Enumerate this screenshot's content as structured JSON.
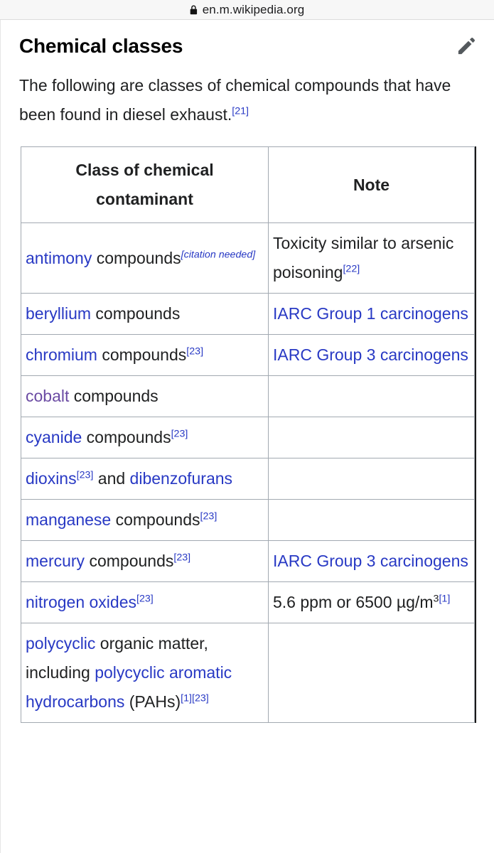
{
  "browser": {
    "lock_icon": "lock-icon",
    "url": "en.m.wikipedia.org"
  },
  "section": {
    "title": "Chemical classes",
    "edit_icon": "pencil-icon",
    "intro_text": "The following are classes of chemical compounds that have been found in diesel exhaust.",
    "intro_ref": "[21]"
  },
  "colors": {
    "link_blue": "#2839c4",
    "visited_purple": "#6b4ba3",
    "table_border": "#a2a9b1",
    "text": "#202122"
  },
  "table": {
    "headers": [
      "Class of chemical contaminant",
      "Note"
    ],
    "rows": [
      {
        "contaminant": {
          "link": "antimony",
          "link_state": "unvisited",
          "after": " compounds",
          "refs": [
            "[citation needed]"
          ],
          "ref_style": "citation-needed"
        },
        "note": {
          "text": "Toxicity similar to arsenic poisoning",
          "refs": [
            "[22]"
          ],
          "is_link": false
        }
      },
      {
        "contaminant": {
          "link": "beryllium",
          "link_state": "unvisited",
          "after": " compounds",
          "refs": []
        },
        "note": {
          "text": "IARC Group 1 carcinogens",
          "refs": [],
          "is_link": true
        }
      },
      {
        "contaminant": {
          "link": "chromium",
          "link_state": "unvisited",
          "after": " compounds",
          "refs": [
            "[23]"
          ]
        },
        "note": {
          "text": "IARC Group 3 carcinogens",
          "refs": [],
          "is_link": true
        }
      },
      {
        "contaminant": {
          "link": "cobalt",
          "link_state": "visited",
          "after": " compounds",
          "refs": []
        },
        "note": {
          "text": "",
          "refs": [],
          "is_link": false
        }
      },
      {
        "contaminant": {
          "link": "cyanide",
          "link_state": "unvisited",
          "after": " compounds",
          "refs": [
            "[23]"
          ]
        },
        "note": {
          "text": "",
          "refs": [],
          "is_link": false
        }
      },
      {
        "contaminant": {
          "link": "dioxins",
          "link_state": "unvisited",
          "after": "",
          "refs": [
            "[23]"
          ],
          "tail_text": " and ",
          "tail_link": "dibenzofurans"
        },
        "note": {
          "text": "",
          "refs": [],
          "is_link": false
        }
      },
      {
        "contaminant": {
          "link": "manganese",
          "link_state": "unvisited",
          "after": " compounds",
          "refs": [
            "[23]"
          ]
        },
        "note": {
          "text": "",
          "refs": [],
          "is_link": false
        }
      },
      {
        "contaminant": {
          "link": "mercury",
          "link_state": "unvisited",
          "after": " compounds",
          "refs": [
            "[23]"
          ]
        },
        "note": {
          "text": "IARC Group 3 carcinogens",
          "refs": [],
          "is_link": true
        }
      },
      {
        "contaminant": {
          "link": "nitrogen oxides",
          "link_state": "unvisited",
          "after": "",
          "refs": [
            "[23]"
          ]
        },
        "note": {
          "text": "5.6 ppm or 6500 µg/m3",
          "note_prefix": "5.6 ppm or 6500 µg/m",
          "note_sup": "3",
          "refs": [
            "[1]"
          ],
          "is_link": false
        }
      },
      {
        "contaminant": {
          "link": "polycyclic",
          "link_state": "unvisited",
          "after": " organic matter, including ",
          "link2": "polycyclic aromatic hydrocarbons",
          "after2": " (PAHs)",
          "refs": [
            "[1]",
            "[23]"
          ]
        },
        "note": {
          "text": "",
          "refs": [],
          "is_link": false
        }
      }
    ]
  }
}
